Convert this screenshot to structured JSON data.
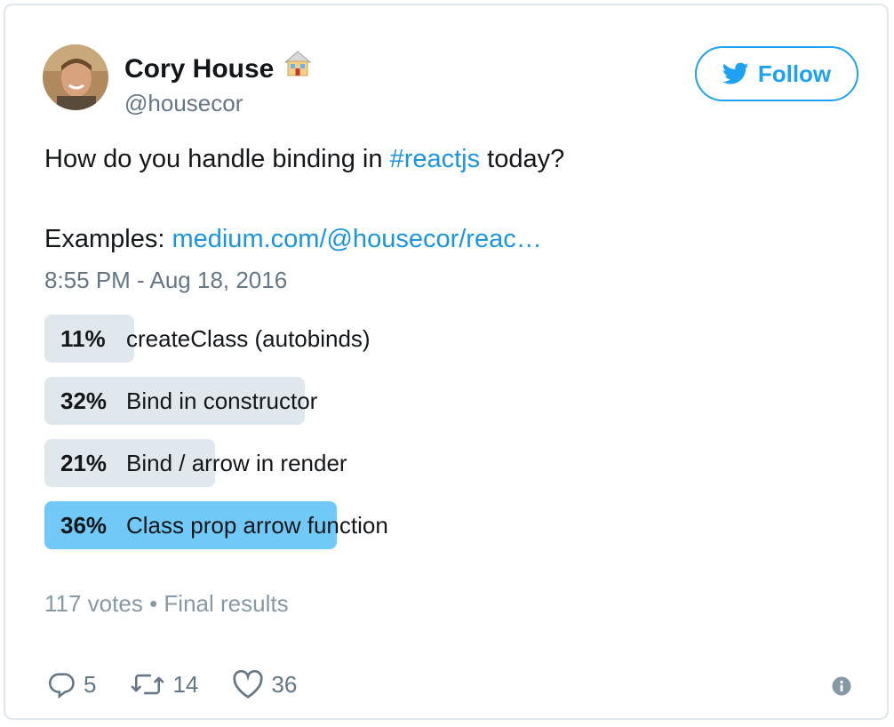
{
  "author": {
    "name": "Cory House",
    "name_emoji": "house-emoji",
    "handle": "@housecor"
  },
  "follow_button": {
    "label": "Follow",
    "icon": "twitter-bird-icon"
  },
  "tweet": {
    "line1_prefix": "How do you handle binding in ",
    "line1_hashtag": "#reactjs",
    "line1_suffix": " today?",
    "line2_prefix": "Examples: ",
    "line2_link": "medium.com/@housecor/reac…",
    "timestamp": "8:55 PM - Aug 18, 2016"
  },
  "poll": {
    "options": [
      {
        "percent_label": "11%",
        "value": 0.11,
        "choice": "createClass (autobinds)",
        "winner": false
      },
      {
        "percent_label": "32%",
        "value": 0.32,
        "choice": "Bind in constructor",
        "winner": false
      },
      {
        "percent_label": "21%",
        "value": 0.21,
        "choice": "Bind / arrow in render",
        "winner": false
      },
      {
        "percent_label": "36%",
        "value": 0.36,
        "choice": "Class prop arrow function",
        "winner": true
      }
    ],
    "votes": "117 votes",
    "separator": "•",
    "status": "Final results"
  },
  "actions": {
    "reply_count": "5",
    "retweet_count": "14",
    "like_count": "36"
  },
  "colors": {
    "link": "#1b95e0",
    "follow": "#1da1f2",
    "bar": "#e1e8ed",
    "winner_bar": "#71c9f8",
    "muted": "#657786"
  }
}
